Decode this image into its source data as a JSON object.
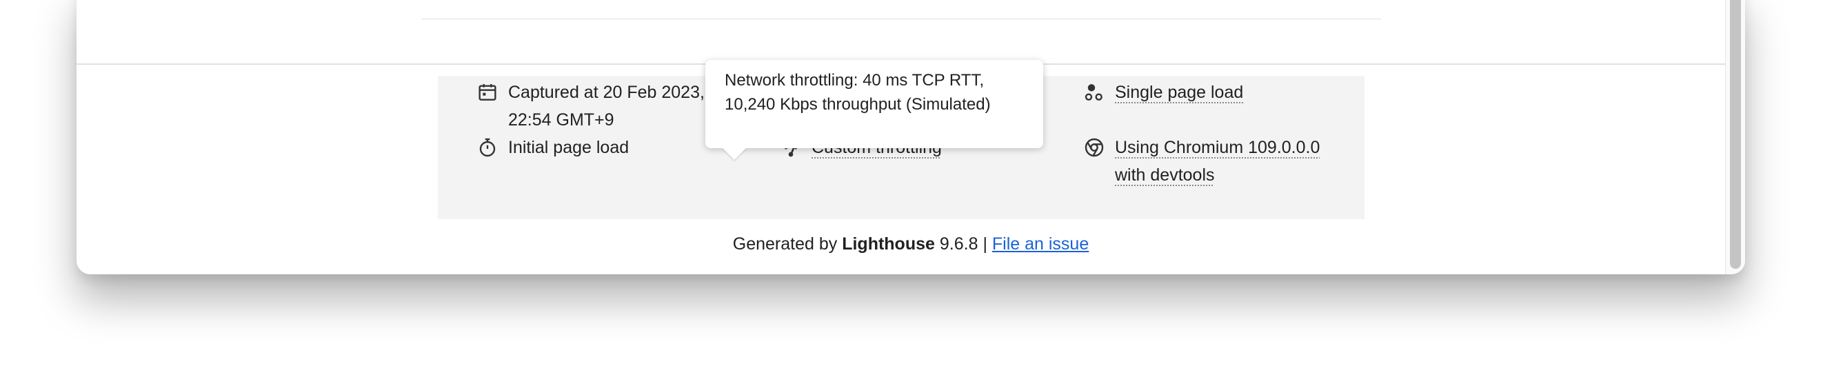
{
  "info": {
    "captured": {
      "line1": "Captured at 20 Feb 2023,",
      "line2": "22:54 GMT+9"
    },
    "initial_load": "Initial page load",
    "throttling": "Custom throttling",
    "single_page": "Single page load",
    "chromium": {
      "line1": "Using Chromium 109.0.0.0",
      "line2": "with devtools"
    }
  },
  "tooltip": {
    "line1": "Network throttling: 40 ms TCP RTT,",
    "line2": "10,240 Kbps throughput (Simulated)"
  },
  "footer": {
    "prefix": "Generated by",
    "brand": "Lighthouse",
    "version": "9.6.8",
    "separator": "|",
    "link": "File an issue"
  },
  "colors": {
    "link": "#1a62d6",
    "panel": "#f3f3f3"
  },
  "icons": [
    "calendar-icon",
    "stopwatch-icon",
    "network-icon",
    "samples-icon",
    "chrome-icon"
  ]
}
